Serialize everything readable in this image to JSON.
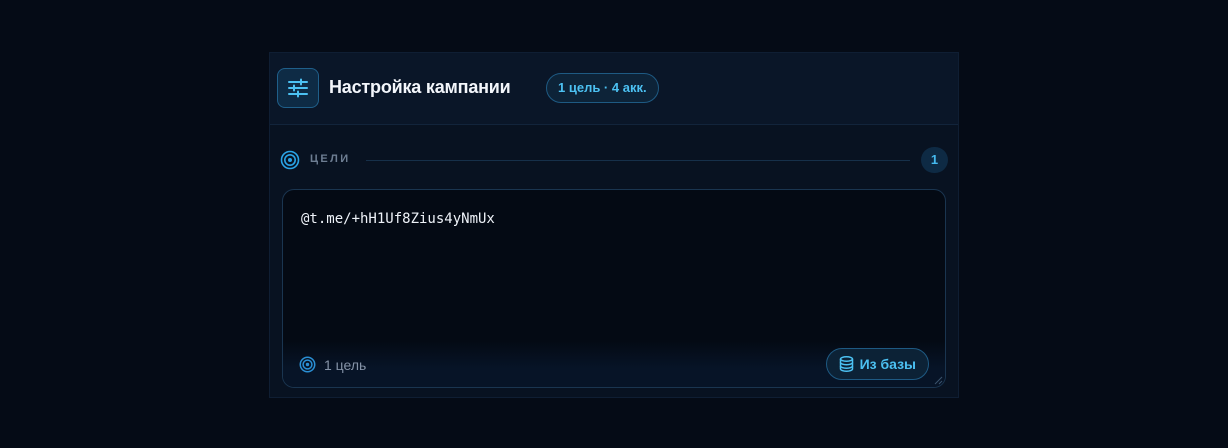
{
  "header": {
    "title": "Настройка кампании",
    "badge": "1 цель · 4 акк.",
    "settings_icon": "sliders-icon"
  },
  "targets_section": {
    "label": "ЦЕЛИ",
    "count": "1",
    "icon": "target-icon"
  },
  "textbox": {
    "value": "@t.me/+hH1Uf8Zius4yNmUx"
  },
  "footer": {
    "count_label": "1 цель",
    "icon": "target-icon",
    "db_button_label": "Из базы",
    "db_button_icon": "database-icon"
  },
  "colors": {
    "background": "#050b16",
    "panel": "#081221",
    "accent": "#4cc1f2",
    "accent_border": "#1e5a83"
  }
}
